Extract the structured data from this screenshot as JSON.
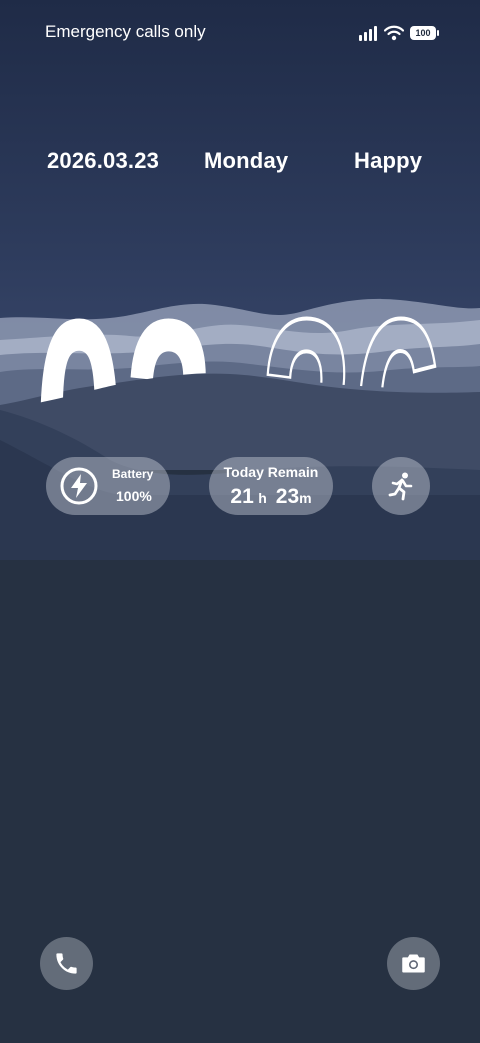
{
  "status_bar": {
    "carrier_text": "Emergency calls only",
    "icons": [
      "signal-icon",
      "wifi-icon",
      "battery-icon"
    ],
    "battery_level": "100"
  },
  "lockscreen": {
    "date": "2026.03.23",
    "weekday": "Monday",
    "greeting": "Happy",
    "time": {
      "hours": "02",
      "minutes": "36"
    }
  },
  "widgets": {
    "battery": {
      "icon": "lightning-icon",
      "label": "Battery",
      "value": "100%"
    },
    "remaining": {
      "label": "Today Remain",
      "hours": "21",
      "hours_unit": "h",
      "minutes": "23",
      "minutes_unit": "m"
    },
    "activity": {
      "icon": "running-person-icon"
    }
  },
  "shortcuts": {
    "left": "phone-icon",
    "right": "camera-icon"
  },
  "colors": {
    "sky_top": "#1f2b47",
    "sky_bottom": "#3a4a6e",
    "ground": "#263142",
    "mountain_light": "#a3adc3",
    "mountain_dark": "#3d4a63"
  }
}
